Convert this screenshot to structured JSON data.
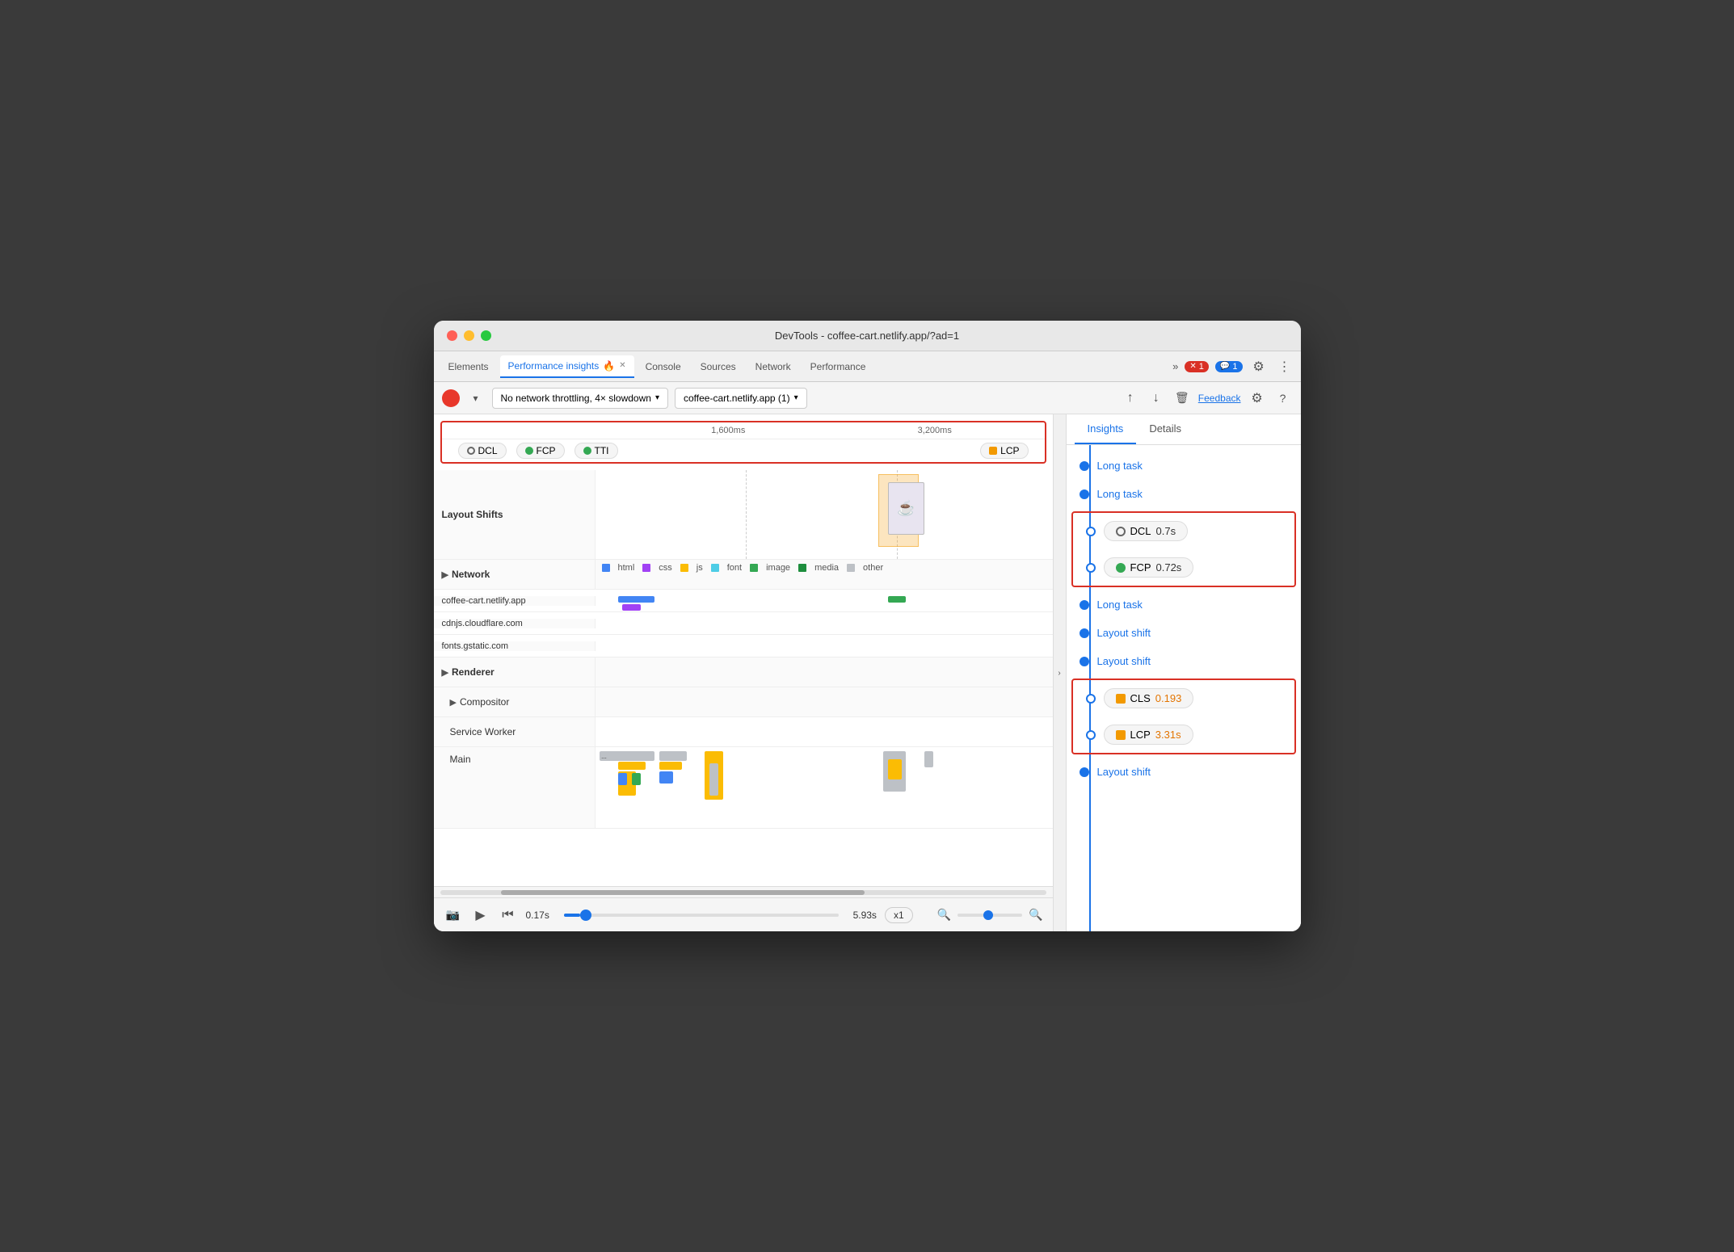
{
  "window": {
    "title": "DevTools - coffee-cart.netlify.app/?ad=1"
  },
  "tabs": {
    "items": [
      {
        "label": "Elements",
        "active": false,
        "id": "elements"
      },
      {
        "label": "Performance insights",
        "active": true,
        "id": "perf-insights"
      },
      {
        "label": "Console",
        "active": false,
        "id": "console"
      },
      {
        "label": "Sources",
        "active": false,
        "id": "sources"
      },
      {
        "label": "Network",
        "active": false,
        "id": "network"
      },
      {
        "label": "Performance",
        "active": false,
        "id": "performance"
      }
    ],
    "more_label": "»",
    "error_count": "1",
    "info_count": "1"
  },
  "toolbar": {
    "network_throttle": "No network throttling, 4× slowdown",
    "target": "coffee-cart.netlify.app (1)",
    "feedback_label": "Feedback"
  },
  "timeline": {
    "time_markers": [
      "1,600ms",
      "3,200ms"
    ],
    "markers": [
      {
        "label": "DCL",
        "type": "empty"
      },
      {
        "label": "FCP",
        "type": "green"
      },
      {
        "label": "TTI",
        "type": "green"
      },
      {
        "label": "LCP",
        "type": "square"
      }
    ],
    "tracks": [
      {
        "label": "Layout Shifts",
        "bold": true,
        "type": "layout-shifts"
      },
      {
        "label": "Network",
        "bold": true,
        "type": "network",
        "expandable": true
      },
      {
        "label": "coffee-cart.netlify.app",
        "bold": false,
        "type": "net-row"
      },
      {
        "label": "cdnjs.cloudflare.com",
        "bold": false,
        "type": "net-row"
      },
      {
        "label": "fonts.gstatic.com",
        "bold": false,
        "type": "net-row"
      },
      {
        "label": "Renderer",
        "bold": true,
        "type": "section",
        "expandable": true
      },
      {
        "label": "Compositor",
        "bold": false,
        "type": "section",
        "expandable": true
      },
      {
        "label": "Service Worker",
        "bold": false,
        "type": "section"
      },
      {
        "label": "Main",
        "bold": false,
        "type": "flame"
      }
    ],
    "network_legend": [
      "html",
      "css",
      "js",
      "font",
      "image",
      "media",
      "other"
    ]
  },
  "playback": {
    "start_time": "0.17s",
    "end_time": "5.93s",
    "speed": "x1"
  },
  "insights": {
    "tabs": [
      "Insights",
      "Details"
    ],
    "active_tab": "Insights",
    "items": [
      {
        "type": "link",
        "label": "Long task",
        "boxed": false
      },
      {
        "type": "link",
        "label": "Long task",
        "boxed": false
      },
      {
        "type": "badge",
        "icon": "circle-empty",
        "label": "DCL",
        "value": "0.7s",
        "orange": false,
        "boxed_start": true
      },
      {
        "type": "badge",
        "icon": "circle-green",
        "label": "FCP",
        "value": "0.72s",
        "orange": false,
        "boxed_end": true
      },
      {
        "type": "link",
        "label": "Long task",
        "boxed": false
      },
      {
        "type": "link",
        "label": "Layout shift",
        "boxed": false
      },
      {
        "type": "link",
        "label": "Layout shift",
        "boxed": false
      },
      {
        "type": "badge",
        "icon": "square-orange",
        "label": "CLS",
        "value": "0.193",
        "orange": true,
        "boxed_start": true
      },
      {
        "type": "badge",
        "icon": "square-orange",
        "label": "LCP",
        "value": "3.31s",
        "orange": true,
        "boxed_end": true
      },
      {
        "type": "link",
        "label": "Layout shift",
        "boxed": false
      }
    ]
  }
}
